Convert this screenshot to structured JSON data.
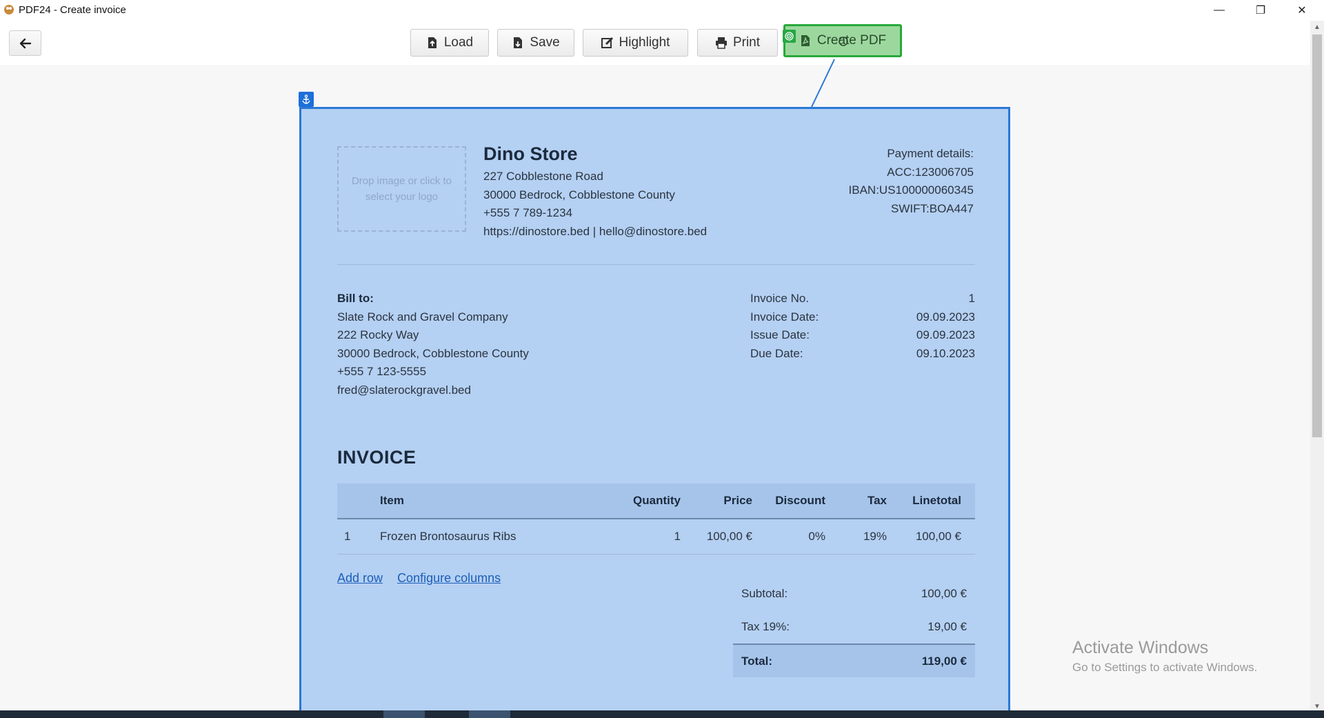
{
  "window": {
    "title": "PDF24 - Create invoice",
    "controls": {
      "minimize": "—",
      "maximize": "❐",
      "close": "✕"
    }
  },
  "toolbar": {
    "back_icon": "arrow-left-icon",
    "buttons": {
      "load": "Load",
      "save": "Save",
      "highlight": "Highlight",
      "print": "Print",
      "create_pdf": "Create PDF"
    },
    "accent_color": "#27a83a"
  },
  "invoice": {
    "logo_placeholder": "Drop image or click to select your logo",
    "company": {
      "name": "Dino Store",
      "address1": "227 Cobblestone Road",
      "address2": "30000 Bedrock, Cobblestone County",
      "phone": "+555 7 789-1234",
      "web_email": "https://dinostore.bed | hello@dinostore.bed"
    },
    "payment": {
      "heading": "Payment details:",
      "acc": "ACC:123006705",
      "iban": "IBAN:US100000060345",
      "swift": "SWIFT:BOA447"
    },
    "bill_to": {
      "heading": "Bill to:",
      "name": "Slate Rock and Gravel Company",
      "address1": "222 Rocky Way",
      "address2": "30000 Bedrock, Cobblestone County",
      "phone": "+555 7 123-5555",
      "email": "fred@slaterockgravel.bed"
    },
    "meta": [
      {
        "label": "Invoice No.",
        "value": "1"
      },
      {
        "label": "Invoice Date:",
        "value": "09.09.2023"
      },
      {
        "label": "Issue Date:",
        "value": "09.09.2023"
      },
      {
        "label": "Due Date:",
        "value": "09.10.2023"
      }
    ],
    "title": "INVOICE",
    "columns": [
      "",
      "Item",
      "Quantity",
      "Price",
      "Discount",
      "Tax",
      "Linetotal"
    ],
    "rows": [
      {
        "num": "1",
        "item": "Frozen Brontosaurus Ribs",
        "qty": "1",
        "price": "100,00 €",
        "discount": "0%",
        "tax": "19%",
        "linetotal": "100,00 €"
      }
    ],
    "links": {
      "add_row": "Add row",
      "configure_columns": "Configure columns"
    },
    "totals": {
      "subtotal_label": "Subtotal:",
      "subtotal_value": "100,00 €",
      "tax_label": "Tax 19%:",
      "tax_value": "19,00 €",
      "total_label": "Total:",
      "total_value": "119,00 €"
    }
  },
  "watermark": {
    "line1": "Activate Windows",
    "line2": "Go to Settings to activate Windows."
  },
  "scrollbar": {
    "up": "▲",
    "down": "▼"
  }
}
